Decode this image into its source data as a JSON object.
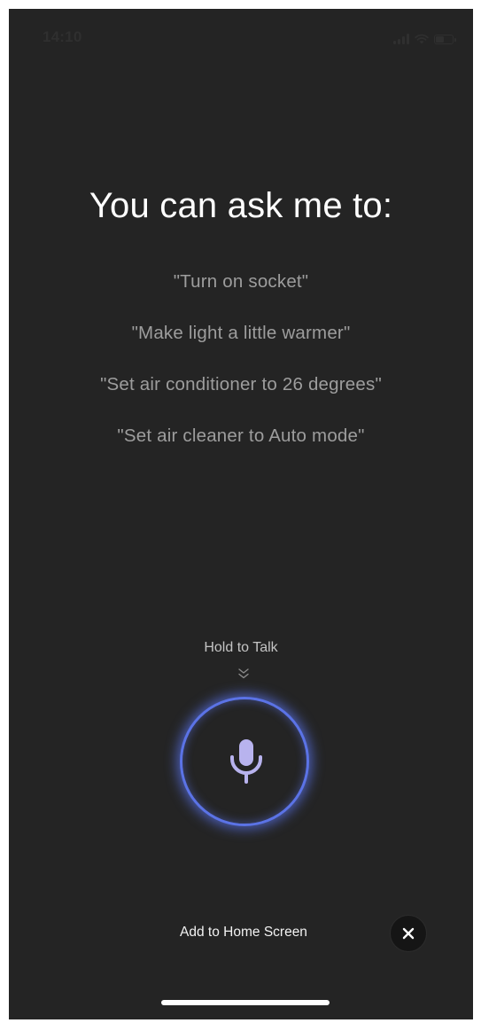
{
  "status_bar": {
    "time": "14:10",
    "icons": [
      "signal-icon",
      "wifi-icon",
      "battery-icon"
    ]
  },
  "heading": "You can ask me to:",
  "suggestions": [
    "\"Turn on socket\"",
    "\"Make light a little warmer\"",
    "\"Set air conditioner to 26 degrees\"",
    "\"Set air cleaner to Auto mode\""
  ],
  "voice": {
    "hold_label": "Hold to Talk",
    "hint_icon": "chevron-double-down-icon",
    "mic_icon": "microphone-icon",
    "accent_color": "#5b73e6"
  },
  "bottom": {
    "add_to_home_label": "Add to Home Screen",
    "close_icon": "close-icon"
  },
  "colors": {
    "background": "#242424",
    "heading": "#ffffff",
    "suggestion": "#9d9d9d",
    "mic_glyph": "#b8b3ee"
  }
}
